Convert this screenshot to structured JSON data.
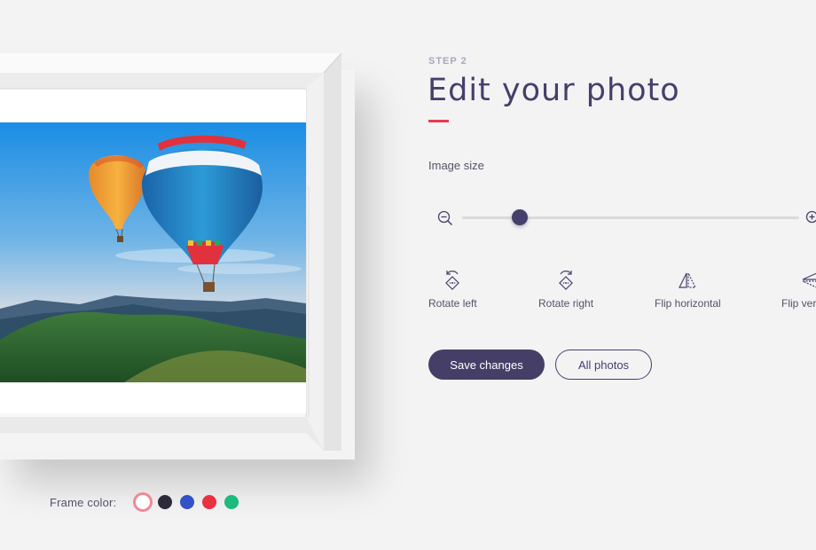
{
  "editor": {
    "step": "STEP 2",
    "title": "Edit your photo",
    "image_size_label": "Image size",
    "zoom": {
      "value": 0.17
    },
    "tools": [
      {
        "label": "Rotate left",
        "icon": "rotate-left-icon"
      },
      {
        "label": "Rotate right",
        "icon": "rotate-right-icon"
      },
      {
        "label": "Flip horizontal",
        "icon": "flip-horizontal-icon"
      },
      {
        "label": "Flip vertical",
        "icon": "flip-vertical-icon"
      }
    ],
    "save_label": "Save changes",
    "all_photos_label": "All photos"
  },
  "frame_color": {
    "label": "Frame color:",
    "options": [
      "#ffffff",
      "#2d2b3a",
      "#3551c8",
      "#e8323e",
      "#1dba7d"
    ],
    "selected": 0
  },
  "colors": {
    "accent": "#e73c4e",
    "primary": "#453f68",
    "selection_ring": "#ee8a97"
  }
}
